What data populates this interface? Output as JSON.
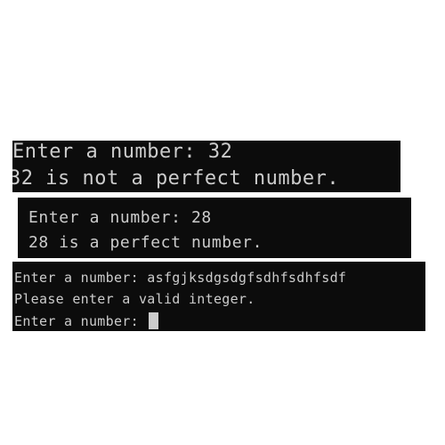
{
  "theme": {
    "terminal_bg": "#0c0c0c",
    "terminal_fg": "#cccccc",
    "page_bg": "#ffffff"
  },
  "panels": [
    {
      "lines": [
        "Enter a number: 32",
        "32 is not a perfect number."
      ]
    },
    {
      "lines": [
        "Enter a number: 28",
        "28 is a perfect number."
      ]
    },
    {
      "lines": [
        "Enter a number: asfgjksdgsdgfsdhfsdhfsdf",
        "Please enter a valid integer.",
        "Enter a number: "
      ]
    }
  ]
}
